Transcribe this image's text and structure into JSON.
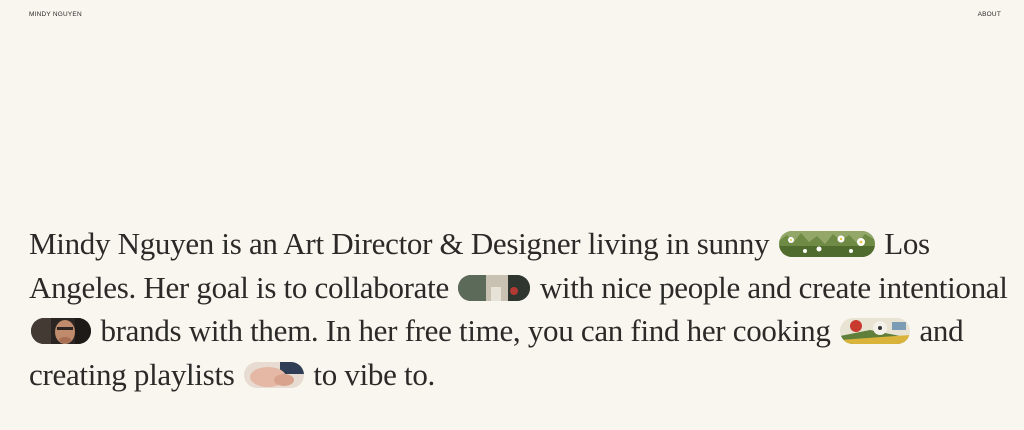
{
  "header": {
    "name_label": "MINDY NGUYEN",
    "about_label": "ABOUT"
  },
  "bio": {
    "segment_1": "Mindy Nguyen is an Art Director & Designer living in sunny",
    "segment_2": "Los Angeles. Her goal is to collaborate",
    "segment_3": "with nice people and create intentional",
    "segment_4": "brands with them. In her free time, you can find her cooking",
    "segment_5": "and creating playlists",
    "segment_6": "to vibe to."
  },
  "colors": {
    "background": "#f9f6f0",
    "text": "#2b2a28"
  },
  "inline_images": [
    "meadow-flowers-photo",
    "collaboration-photo",
    "portrait-photo",
    "cooking-photo",
    "music-hands-photo"
  ]
}
